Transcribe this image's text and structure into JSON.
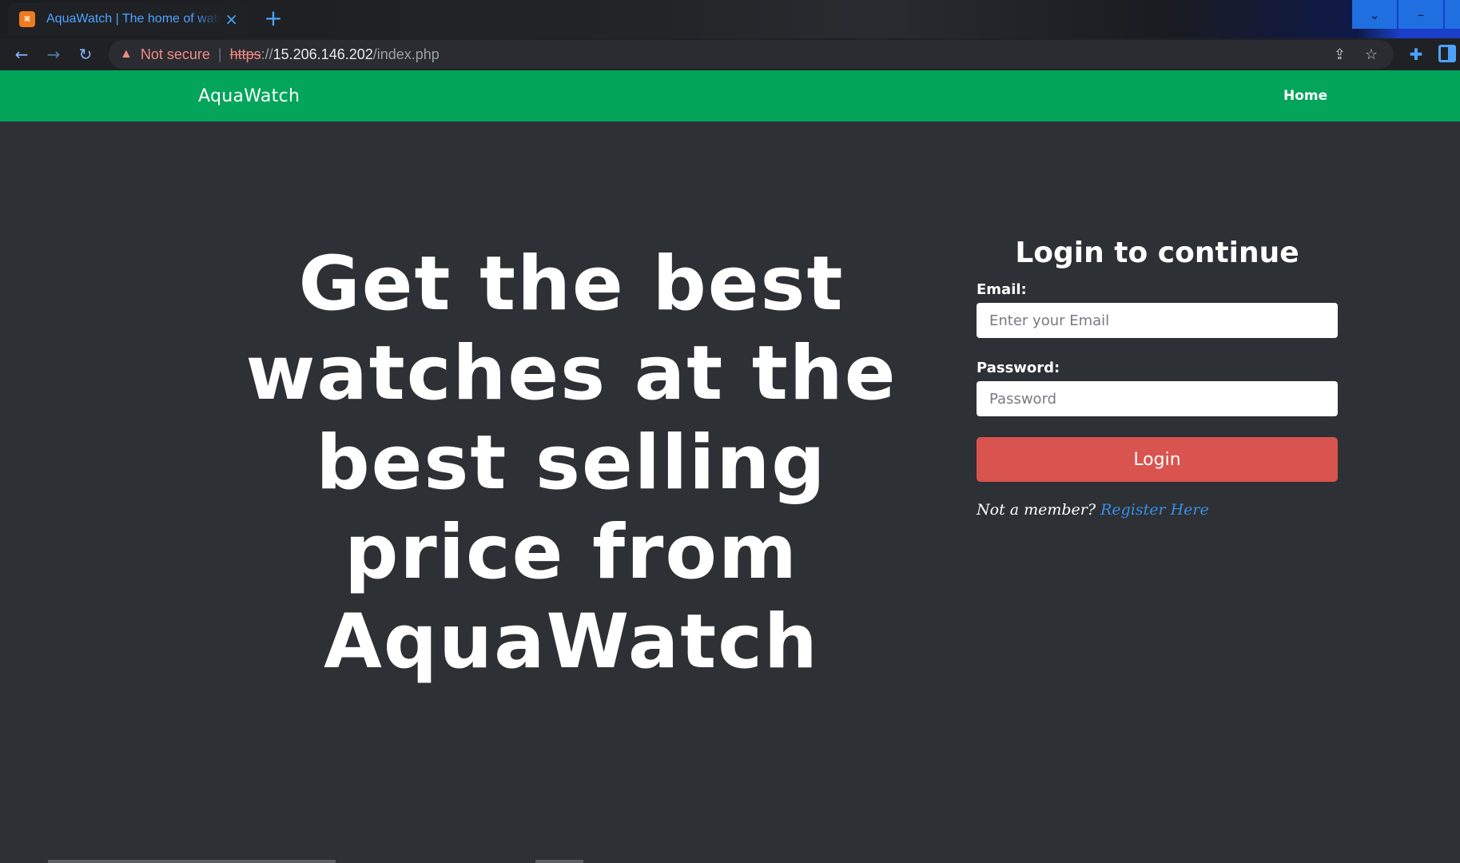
{
  "browser": {
    "tab": {
      "title": "AquaWatch | The home of watches",
      "favicon_text": "⌘",
      "close_glyph": "×"
    },
    "new_tab_glyph": "+",
    "window_controls": [
      "⌄",
      "–",
      ""
    ],
    "nav": {
      "back_glyph": "←",
      "forward_glyph": "→",
      "reload_glyph": "↻"
    },
    "address": {
      "warning_glyph": "▲",
      "security_label": "Not secure",
      "separator": "|",
      "scheme": "https",
      "scheme_sep": "://",
      "host": "15.206.146.202",
      "path": "/index.php"
    },
    "icons": {
      "share": "share-icon",
      "star": "star-icon",
      "extensions": "puzzle-icon",
      "side_panel": "side-panel-icon"
    },
    "share_glyph": "⇪",
    "star_glyph": "☆",
    "ext_glyph": "✚"
  },
  "site": {
    "brand": "AquaWatch",
    "nav_home": "Home",
    "nav_color": "#02a55a"
  },
  "hero": {
    "headline": "Get the best watches at the best selling price from AquaWatch"
  },
  "login": {
    "title": "Login to continue",
    "email_label": "Email:",
    "email_placeholder": "Enter your Email",
    "email_value": "",
    "password_label": "Password:",
    "password_placeholder": "Password",
    "password_value": "",
    "button_label": "Login",
    "button_color": "#d9534f",
    "member_prompt": "Not a member?",
    "register_link": "Register Here"
  }
}
